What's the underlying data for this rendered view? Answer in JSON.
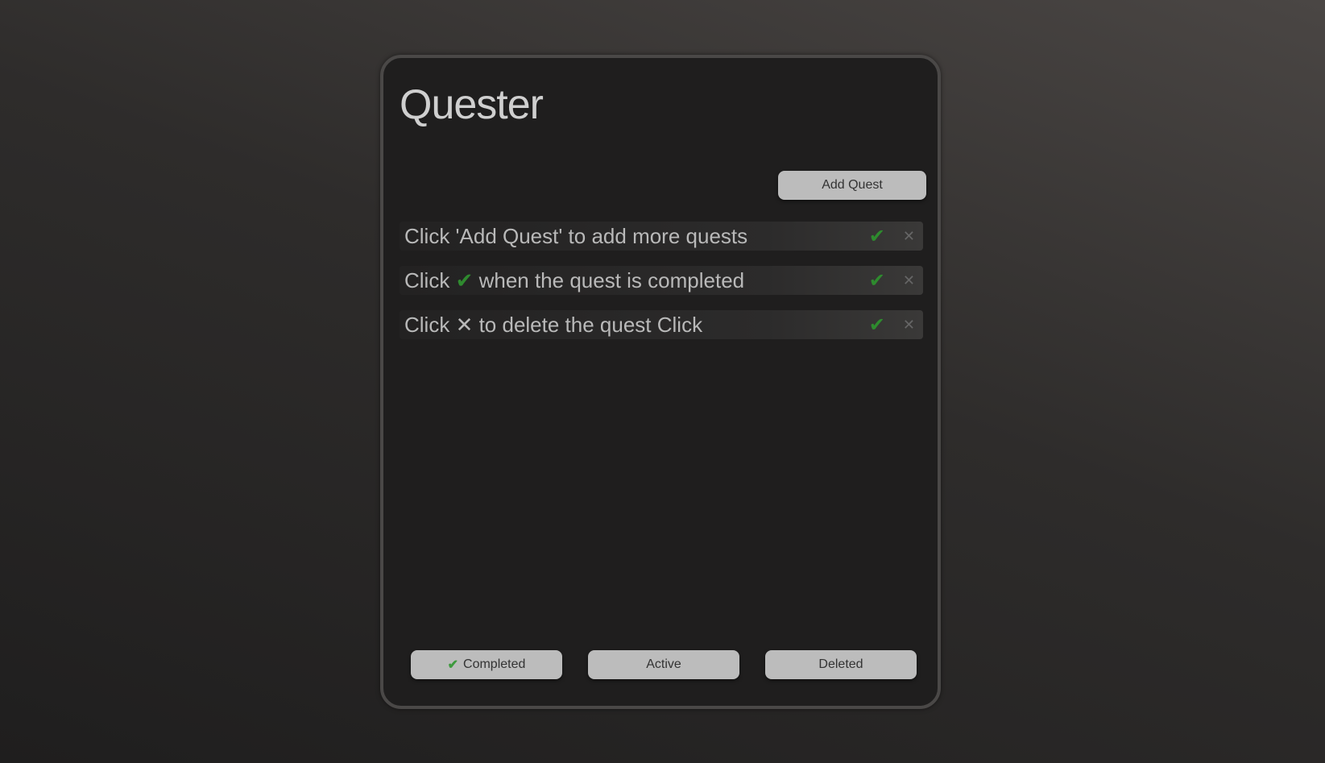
{
  "app": {
    "title": "Quester"
  },
  "toolbar": {
    "add_label": "Add Quest"
  },
  "quests": [
    {
      "pre": "Click 'Add Quest' to add more quests",
      "icon": "",
      "post": ""
    },
    {
      "pre": "Click ",
      "icon": "✔",
      "post": " when the quest is completed"
    },
    {
      "pre": "Click ",
      "icon": "✕",
      "post": " to delete the quest Click"
    }
  ],
  "row_icons": {
    "complete": "✔",
    "delete": "✕"
  },
  "footer": {
    "completed_label": "Completed",
    "active_label": "Active",
    "deleted_label": "Deleted",
    "check": "✔"
  },
  "colors": {
    "accent_green": "#2e8b2e"
  }
}
